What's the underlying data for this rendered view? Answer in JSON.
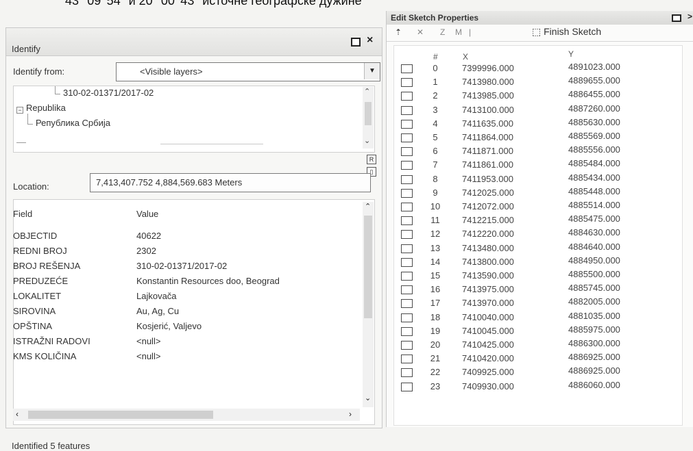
{
  "caption_text": "43° 09' 54'' и 20° 00' 43'' источне географске дужине",
  "identify": {
    "title": "Identify",
    "identify_from_label": "Identify from:",
    "identify_from_value": "<Visible layers>",
    "tree": {
      "item_top": "310-02-01371/2017-02",
      "group": "Republika",
      "group_child": "Република Србија"
    },
    "location_label": "Location:",
    "location_value": "7,413,407.752  4,884,569.683 Meters",
    "header_field": "Field",
    "header_value": "Value",
    "rows": [
      {
        "field": "OBJECTID",
        "value": "40622"
      },
      {
        "field": "REDNI BROJ",
        "value": "2302"
      },
      {
        "field": "BROJ REŠENJA",
        "value": "310-02-01371/2017-02"
      },
      {
        "field": "PREDUZEĆE",
        "value": "Konstantin Resources doo, Beograd"
      },
      {
        "field": "LOKALITET",
        "value": "Lajkovača"
      },
      {
        "field": "SIROVINA",
        "value": "Au, Ag, Cu"
      },
      {
        "field": "OPŠTINA",
        "value": "Kosjerić, Valjevo"
      },
      {
        "field": "ISTRAŽNI RADOVI",
        "value": "<null>"
      },
      {
        "field": "KMS KOLIČINA",
        "value": "<null>"
      }
    ],
    "status": "Identified 5 features"
  },
  "sketch": {
    "title": "Edit Sketch Properties",
    "finish_label": "Finish Sketch",
    "col_num": "#",
    "col_x": "X",
    "col_y": "Y",
    "rows": [
      {
        "n": "0",
        "x": "7399996.000",
        "y": "4891023.000"
      },
      {
        "n": "1",
        "x": "7413980.000",
        "y": "4889655.000"
      },
      {
        "n": "2",
        "x": "7413985.000",
        "y": "4886455.000"
      },
      {
        "n": "3",
        "x": "7413100.000",
        "y": "4887260.000"
      },
      {
        "n": "4",
        "x": "7411635.000",
        "y": "4885630.000"
      },
      {
        "n": "5",
        "x": "7411864.000",
        "y": "4885569.000"
      },
      {
        "n": "6",
        "x": "7411871.000",
        "y": "4885556.000"
      },
      {
        "n": "7",
        "x": "7411861.000",
        "y": "4885484.000"
      },
      {
        "n": "8",
        "x": "7411953.000",
        "y": "4885434.000"
      },
      {
        "n": "9",
        "x": "7412025.000",
        "y": "4885448.000"
      },
      {
        "n": "10",
        "x": "7412072.000",
        "y": "4885514.000"
      },
      {
        "n": "11",
        "x": "7412215.000",
        "y": "4885475.000"
      },
      {
        "n": "12",
        "x": "7412220.000",
        "y": "4884630.000"
      },
      {
        "n": "13",
        "x": "7413480.000",
        "y": "4884640.000"
      },
      {
        "n": "14",
        "x": "7413800.000",
        "y": "4884950.000"
      },
      {
        "n": "15",
        "x": "7413590.000",
        "y": "4885500.000"
      },
      {
        "n": "16",
        "x": "7413975.000",
        "y": "4885745.000"
      },
      {
        "n": "17",
        "x": "7413970.000",
        "y": "4882005.000"
      },
      {
        "n": "18",
        "x": "7410040.000",
        "y": "4881035.000"
      },
      {
        "n": "19",
        "x": "7410045.000",
        "y": "4885975.000"
      },
      {
        "n": "20",
        "x": "7410425.000",
        "y": "4886300.000"
      },
      {
        "n": "21",
        "x": "7410420.000",
        "y": "4886925.000"
      },
      {
        "n": "22",
        "x": "7409925.000",
        "y": "4886925.000"
      },
      {
        "n": "23",
        "x": "7409930.000",
        "y": "4886060.000"
      }
    ]
  }
}
